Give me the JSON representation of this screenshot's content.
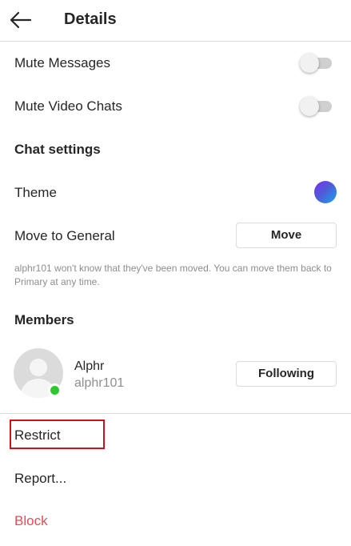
{
  "header": {
    "back_icon": "arrow-left-icon",
    "title": "Details"
  },
  "settings": {
    "mute_messages": {
      "label": "Mute Messages",
      "enabled": false
    },
    "mute_video_chats": {
      "label": "Mute Video Chats",
      "enabled": false
    }
  },
  "chat_settings": {
    "title": "Chat settings",
    "theme": {
      "label": "Theme",
      "gradient_colors": [
        "#7b2ff7",
        "#4f5bd5",
        "#1aa4f0"
      ]
    },
    "move_to_general": {
      "label": "Move to General",
      "button_label": "Move",
      "note": "alphr101 won't know that they've been moved. You can move them back to Primary at any time."
    }
  },
  "members": {
    "title": "Members",
    "list": [
      {
        "name": "Alphr",
        "username": "alphr101",
        "button_label": "Following",
        "online": true,
        "online_color": "#2ec72e"
      }
    ]
  },
  "actions": {
    "restrict": "Restrict",
    "report": "Report...",
    "block": "Block",
    "block_color": "#ed4956",
    "highlight_color": "#d0111b"
  }
}
